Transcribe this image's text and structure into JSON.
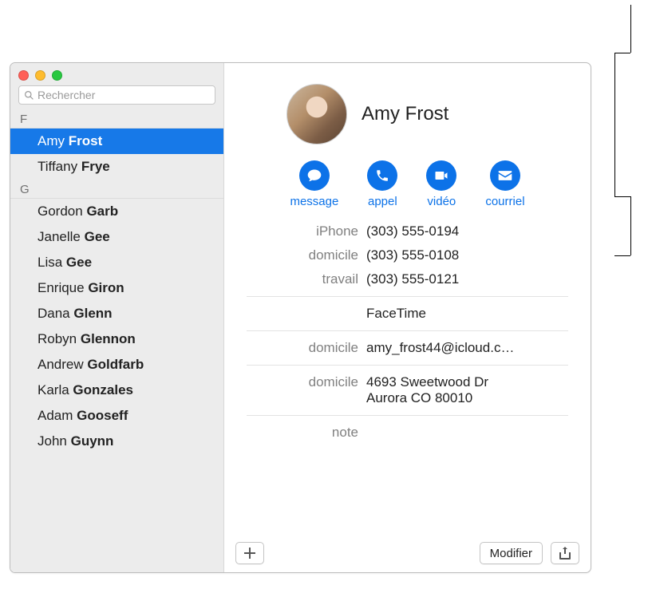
{
  "search": {
    "placeholder": "Rechercher"
  },
  "sections": [
    {
      "letter": "F",
      "contacts": [
        {
          "first": "Amy",
          "last": "Frost",
          "selected": true
        },
        {
          "first": "Tiffany",
          "last": "Frye",
          "selected": false
        }
      ]
    },
    {
      "letter": "G",
      "contacts": [
        {
          "first": "Gordon",
          "last": "Garb"
        },
        {
          "first": "Janelle",
          "last": "Gee"
        },
        {
          "first": "Lisa",
          "last": "Gee"
        },
        {
          "first": "Enrique",
          "last": "Giron"
        },
        {
          "first": "Dana",
          "last": "Glenn"
        },
        {
          "first": "Robyn",
          "last": "Glennon"
        },
        {
          "first": "Andrew",
          "last": "Goldfarb"
        },
        {
          "first": "Karla",
          "last": "Gonzales"
        },
        {
          "first": "Adam",
          "last": "Gooseff"
        },
        {
          "first": "John",
          "last": "Guynn"
        }
      ]
    }
  ],
  "contact": {
    "name": "Amy Frost",
    "actions": {
      "message": "message",
      "call": "appel",
      "video": "vidéo",
      "email": "courriel"
    },
    "phones": [
      {
        "label": "iPhone",
        "value": "(303) 555-0194"
      },
      {
        "label": "domicile",
        "value": "(303) 555-0108"
      },
      {
        "label": "travail",
        "value": "(303) 555-0121"
      }
    ],
    "facetime_label": "FaceTime",
    "email": {
      "label": "domicile",
      "value": "amy_frost44@icloud.c…"
    },
    "address": {
      "label": "domicile",
      "value": "4693 Sweetwood Dr\nAurora CO 80010"
    },
    "note_label": "note"
  },
  "buttons": {
    "edit": "Modifier"
  }
}
